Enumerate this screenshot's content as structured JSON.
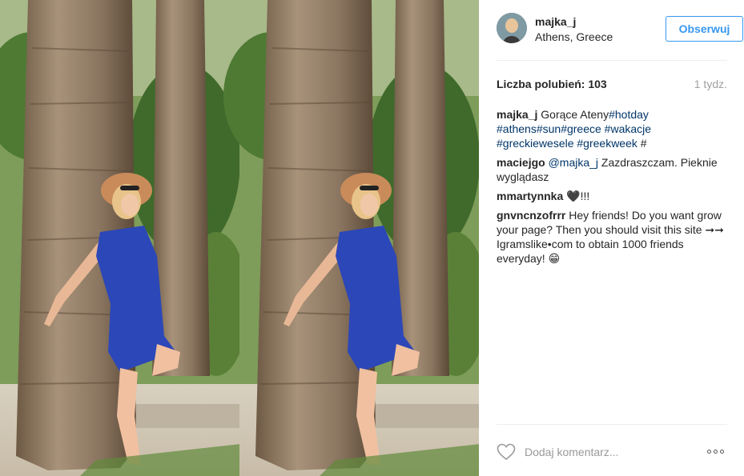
{
  "post": {
    "photo_description": "photo",
    "author": {
      "username": "majka_j",
      "location": "Athens, Greece",
      "follow_label": "Obserwuj"
    },
    "likes_text": "Liczba polubień: 103",
    "time_ago": "1 tydz.",
    "comments": [
      {
        "user": "majka_j",
        "parts": [
          {
            "text": "Gorące Ateny",
            "tag": false
          },
          {
            "text": "#hotday",
            "tag": true
          },
          {
            "text": " ",
            "tag": false
          },
          {
            "text": "#athens",
            "tag": true
          },
          {
            "text": "#sun",
            "tag": true
          },
          {
            "text": "#greece",
            "tag": true
          },
          {
            "text": " ",
            "tag": false
          },
          {
            "text": "#wakacje",
            "tag": true
          },
          {
            "text": " ",
            "tag": false
          },
          {
            "text": "#greckiewesele",
            "tag": true
          },
          {
            "text": " ",
            "tag": false
          },
          {
            "text": "#greekweek",
            "tag": true
          },
          {
            "text": " #",
            "tag": false
          }
        ]
      },
      {
        "user": "maciejgo",
        "parts": [
          {
            "text": "@majka_j",
            "tag": true
          },
          {
            "text": " Zazdraszczam. Pieknie wyglądasz",
            "tag": false
          }
        ]
      },
      {
        "user": "mmartynnka",
        "parts": [
          {
            "text": "🖤!!!",
            "tag": false
          }
        ]
      },
      {
        "user": "gnvncnzofrrr",
        "parts": [
          {
            "text": "Hey friends! Do you want grow your page? Then you should visit this site ➞➞ Igramslike•com to obtain 1000 friends everyday! 😁",
            "tag": false
          }
        ]
      }
    ],
    "add_comment_placeholder": "Dodaj komentarz...",
    "icons": {
      "like": "heart-icon",
      "more": "more-options-icon"
    },
    "colors": {
      "link": "#003569",
      "follow": "#3897f0",
      "muted": "#a0a0a0"
    }
  }
}
